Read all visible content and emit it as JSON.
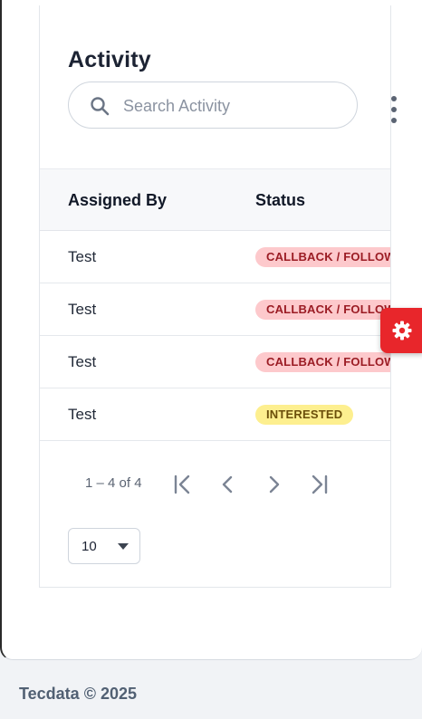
{
  "card": {
    "title": "Activity",
    "search": {
      "placeholder": "Search Activity",
      "value": ""
    }
  },
  "table": {
    "columns": [
      "Assigned By",
      "Status"
    ],
    "rows": [
      {
        "assigned_by": "Test",
        "status": "CALLBACK / FOLLOWUP",
        "status_color": "#fdc9cc"
      },
      {
        "assigned_by": "Test",
        "status": "CALLBACK / FOLLOWUP",
        "status_color": "#fdc9cc"
      },
      {
        "assigned_by": "Test",
        "status": "CALLBACK / FOLLOWUP",
        "status_color": "#fdc9cc"
      },
      {
        "assigned_by": "Test",
        "status": "INTERESTED",
        "status_color": "#fdef8f"
      }
    ]
  },
  "pagination": {
    "range": "1 – 4 of 4",
    "per_page": "10",
    "icons": [
      "first-page-icon",
      "previous-page-icon",
      "next-page-icon",
      "last-page-icon"
    ]
  },
  "settings_fab": {
    "icon": "gear-icon",
    "color": "#e8262b"
  },
  "footer": {
    "text": "Tecdata © 2025"
  }
}
